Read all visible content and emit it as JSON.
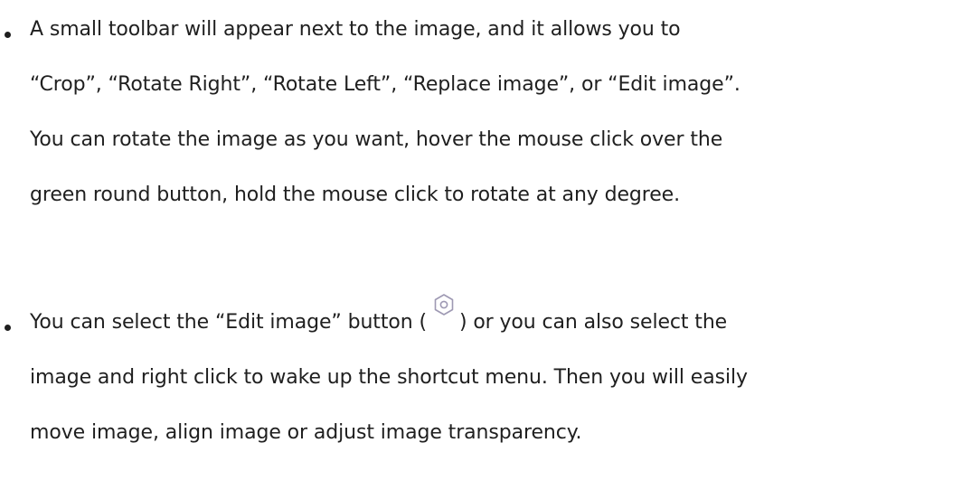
{
  "bullets": [
    {
      "lines": [
        "A small toolbar will appear next to the image, and it allows you to",
        "“Crop”, “Rotate Right”, “Rotate Left”, “Replace image”, or “Edit image”.",
        "You can rotate the image as you want, hover the mouse click over the",
        "green round button, hold the mouse click to rotate at any degree."
      ]
    },
    {
      "line1_before_icon": "You can select the “Edit image” button (",
      "icon": "edit-image-hexagon-icon",
      "line1_after_icon": ") or you can also select the",
      "lines_rest": [
        "image and right click to wake up the shortcut menu. Then you will easily",
        "move image, align image or adjust image transparency."
      ]
    }
  ],
  "colors": {
    "text": "#1f1f1f",
    "icon_stroke": "#9e99b3"
  }
}
